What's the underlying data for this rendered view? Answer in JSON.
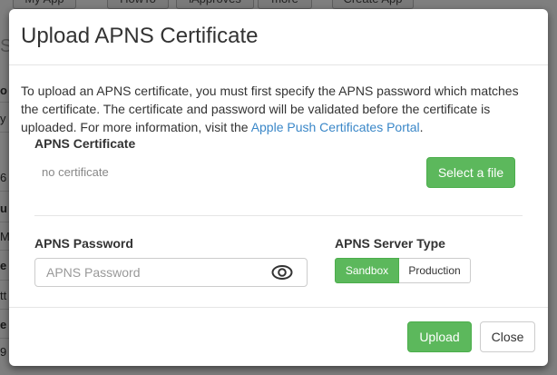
{
  "background": {
    "tabs": [
      "My App",
      "HowTo",
      "iApproves",
      "more",
      "Create App"
    ],
    "row_letters": [
      "S",
      "o",
      "y",
      "6",
      "u",
      "M",
      "e",
      "tt",
      "e",
      "9"
    ]
  },
  "modal": {
    "title": "Upload APNS Certificate",
    "intro_text": "To upload an APNS certificate, you must first specify the APNS password which matches the certificate. The certificate and password will be validated before the certificate is uploaded. For more information, visit the ",
    "intro_link": "Apple Push Certificates Portal",
    "intro_end": ".",
    "certificate": {
      "label": "APNS Certificate",
      "status": "no certificate",
      "select_button": "Select a file"
    },
    "password": {
      "label": "APNS Password",
      "placeholder": "APNS Password",
      "value": ""
    },
    "server_type": {
      "label": "APNS Server Type",
      "options": [
        "Sandbox",
        "Production"
      ],
      "selected": "Sandbox"
    },
    "footer": {
      "upload_button": "Upload",
      "close_button": "Close"
    }
  },
  "colors": {
    "success": "#5cb85c",
    "link": "#3a87c8",
    "overlay": "#000000"
  }
}
